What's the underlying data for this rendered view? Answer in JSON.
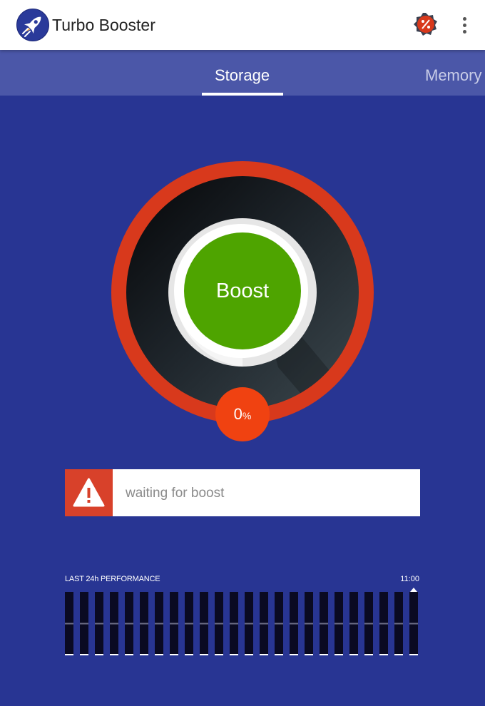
{
  "app": {
    "title": "Turbo Booster",
    "logo_icon": "rocket-icon"
  },
  "toolbar": {
    "badge_icon": "discount-badge-icon",
    "menu_icon": "more-vert-icon"
  },
  "tabs": [
    {
      "label": "Storage",
      "selected": true
    },
    {
      "label": "Memory",
      "selected": false
    }
  ],
  "gauge": {
    "button_label": "Boost",
    "percent_value": "0",
    "percent_unit": "%",
    "ring_color": "#d8391c",
    "button_color": "#4ea400"
  },
  "status": {
    "text": "waiting for boost",
    "icon": "warning-icon",
    "accent": "#d8412a"
  },
  "performance": {
    "label": "LAST 24h PERFORMANCE",
    "time": "11:00",
    "chart_data": {
      "type": "bar",
      "bar_count": 24,
      "values": [
        0,
        0,
        0,
        0,
        0,
        0,
        0,
        0,
        0,
        0,
        0,
        0,
        0,
        0,
        0,
        0,
        0,
        0,
        0,
        0,
        0,
        0,
        0,
        0
      ],
      "current_index": 23
    }
  },
  "colors": {
    "background": "#283593",
    "tabbar": "#4b57a8",
    "appbar": "#ffffff"
  }
}
